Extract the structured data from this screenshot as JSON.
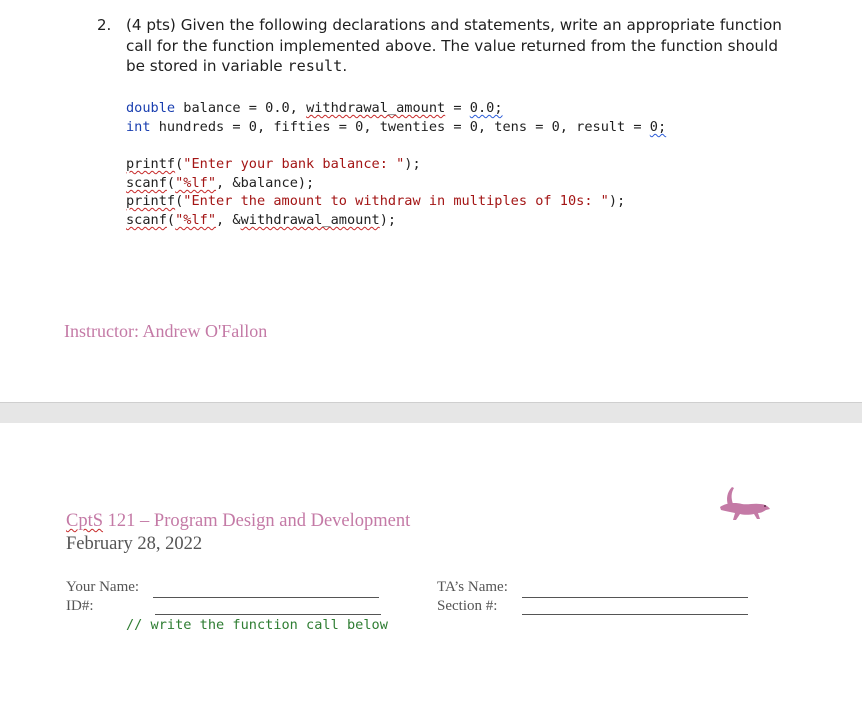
{
  "question": {
    "number": "2.",
    "points": "(4 pts)",
    "text_a": "Given the following declarations and statements, write an appropriate function call for the function implemented above. The value returned from the function should be stored in variable",
    "variable": "result",
    "period": "."
  },
  "code": {
    "kw_double": "double",
    "decl1_a": " balance = 0.0, ",
    "decl1_ident": "withdrawal_amount",
    "decl1_b": " = ",
    "decl1_val": "0.0;",
    "kw_int": "int",
    "decl2_a": " hundreds = 0, fifties = 0, twenties = 0, tens = 0, result = ",
    "decl2_val": "0;",
    "printf": "printf",
    "scanf": "scanf",
    "open_paren": "(",
    "str1": "\"Enter your bank balance: \"",
    "close1": ");",
    "fmt": "\"%lf\"",
    "arg1": ", &balance);",
    "str2": "\"Enter the amount to withdraw in multiples of 10s: \"",
    "arg2_pre": ", &",
    "arg2_ident": "withdrawal_amount",
    "arg2_post": ");"
  },
  "footer": {
    "instructor": "Instructor: Andrew O'Fallon"
  },
  "header2": {
    "course_code": "CptS",
    "course_rest": " 121 – Program Design and Development",
    "date": "February 28, 2022"
  },
  "fields": {
    "your_name": "Your Name:",
    "id": "ID#:",
    "ta_name": "TA’s Name:",
    "section": "Section #:"
  },
  "comment": "// write the function call below",
  "colors": {
    "accent_pink": "#c47aa6",
    "keyword_blue": "#1a3fb0",
    "string_red": "#a31515",
    "comment_green": "#2e7d32"
  }
}
